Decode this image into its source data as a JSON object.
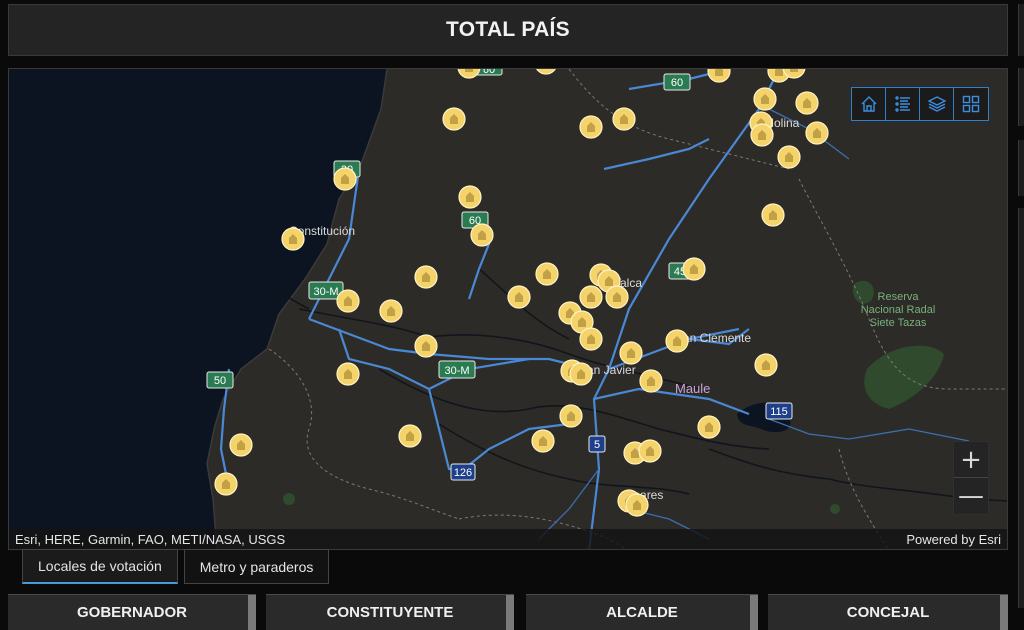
{
  "header": {
    "title": "TOTAL PAÍS"
  },
  "map": {
    "place_labels": [
      "Constitución",
      "Talca",
      "San Clemente",
      "San Javier",
      "Maule",
      "Linares",
      "Molina"
    ],
    "park_label": [
      "Reserva",
      "Nacional Radal",
      "Siete Tazas"
    ],
    "route_shields": [
      "60",
      "30",
      "60",
      "30-M",
      "30-M",
      "50",
      "126",
      "5",
      "115",
      "45"
    ],
    "attribution_left": "Esri, HERE, Garmin, FAO, METI/NASA, USGS",
    "attribution_right": "Powered by Esri",
    "toolbar": [
      "home-icon",
      "legend-list-icon",
      "layers-icon",
      "basemap-gallery-icon"
    ],
    "zoom_in": "+",
    "zoom_out": "—",
    "marker_color": "#f5d36b",
    "accent_color": "#2f7fd0"
  },
  "tabs": [
    {
      "label": "Locales de votación",
      "active": true
    },
    {
      "label": "Metro y paraderos",
      "active": false
    }
  ],
  "categories": [
    "GOBERNADOR",
    "CONSTITUYENTE",
    "ALCALDE",
    "CONCEJAL"
  ]
}
